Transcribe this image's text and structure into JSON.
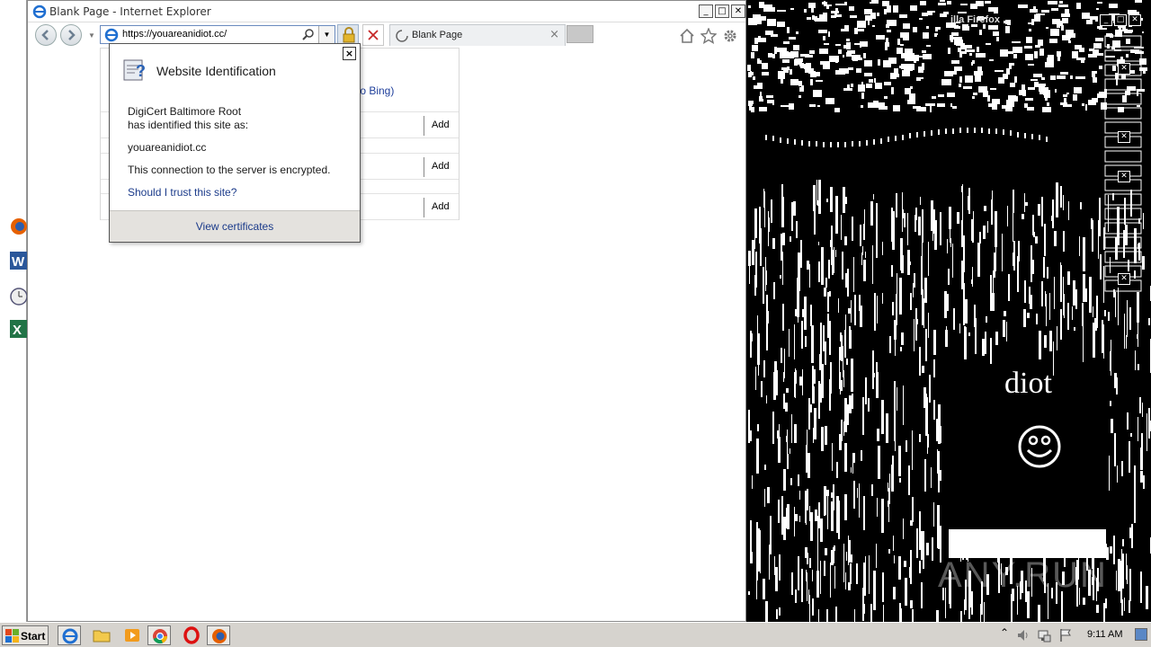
{
  "ie": {
    "title": "Blank Page - Internet Explorer",
    "address": "https://youareanidiot.cc/",
    "tab_label": "Blank Page",
    "bg_bing_text": "to Bing)",
    "add_label": "Add",
    "window_controls": [
      "minimize",
      "maximize",
      "close"
    ]
  },
  "popup": {
    "heading": "Website Identification",
    "issuer_line1": "DigiCert Baltimore Root",
    "issuer_line2": "has identified this site as:",
    "site": "youareanidiot.cc",
    "encrypted": "This connection to the server is encrypted.",
    "trust_link": "Should I trust this site?",
    "view_certificates": "View certificates",
    "close_symbol": "×"
  },
  "firefox": {
    "title_fragment": "illa Firefox",
    "page_text": "diot",
    "watermark": "ANY.RUN"
  },
  "taskbar": {
    "start_label": "Start",
    "clock": "9:11 AM",
    "pinned": [
      "internet-explorer-icon",
      "folder-icon",
      "media-player-icon",
      "chrome-icon",
      "opera-icon",
      "firefox-icon"
    ]
  },
  "colors": {
    "link": "#1a3a8a",
    "taskbar": "#d6d3ce",
    "popup_footer": "#e4e2de"
  }
}
